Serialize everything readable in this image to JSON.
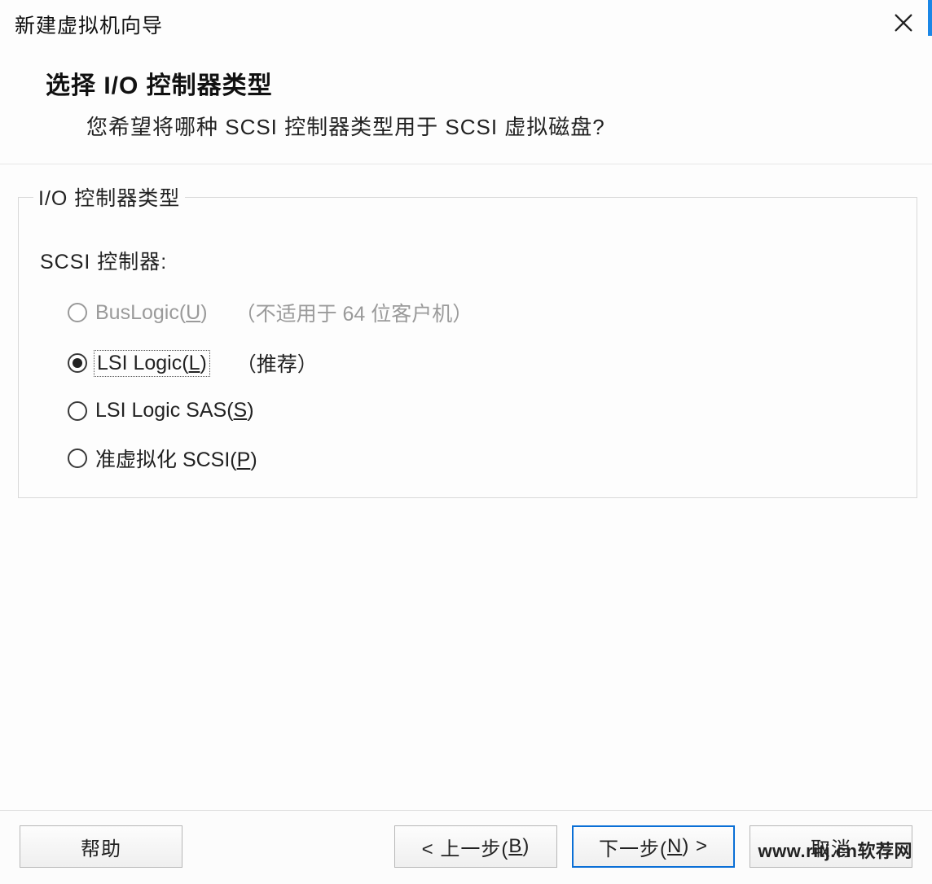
{
  "window": {
    "title": "新建虚拟机向导"
  },
  "header": {
    "title": "选择 I/O 控制器类型",
    "subtitle": "您希望将哪种 SCSI 控制器类型用于 SCSI 虚拟磁盘?"
  },
  "group": {
    "legend": "I/O 控制器类型",
    "list_label": "SCSI 控制器:"
  },
  "options": [
    {
      "id": "buslogic",
      "label_pre": "BusLogic(",
      "accel": "U",
      "label_post": ")",
      "note": "（不适用于 64 位客户机）",
      "disabled": true,
      "checked": false
    },
    {
      "id": "lsilogic",
      "label_pre": "LSI Logic(",
      "accel": "L",
      "label_post": ")",
      "note": "（推荐）",
      "disabled": false,
      "checked": true,
      "focused": true
    },
    {
      "id": "lsisas",
      "label_pre": "LSI Logic SAS(",
      "accel": "S",
      "label_post": ")",
      "note": "",
      "disabled": false,
      "checked": false
    },
    {
      "id": "pvscsi",
      "label_pre": "准虚拟化 SCSI(",
      "accel": "P",
      "label_post": ")",
      "note": "",
      "disabled": false,
      "checked": false
    }
  ],
  "footer": {
    "help": "帮助",
    "back_pre": "< 上一步(",
    "back_accel": "B",
    "back_post": ")",
    "next_pre": "下一步(",
    "next_accel": "N",
    "next_post": ") >",
    "cancel": "取消"
  },
  "watermark": "www.ritj.cn软荐网"
}
